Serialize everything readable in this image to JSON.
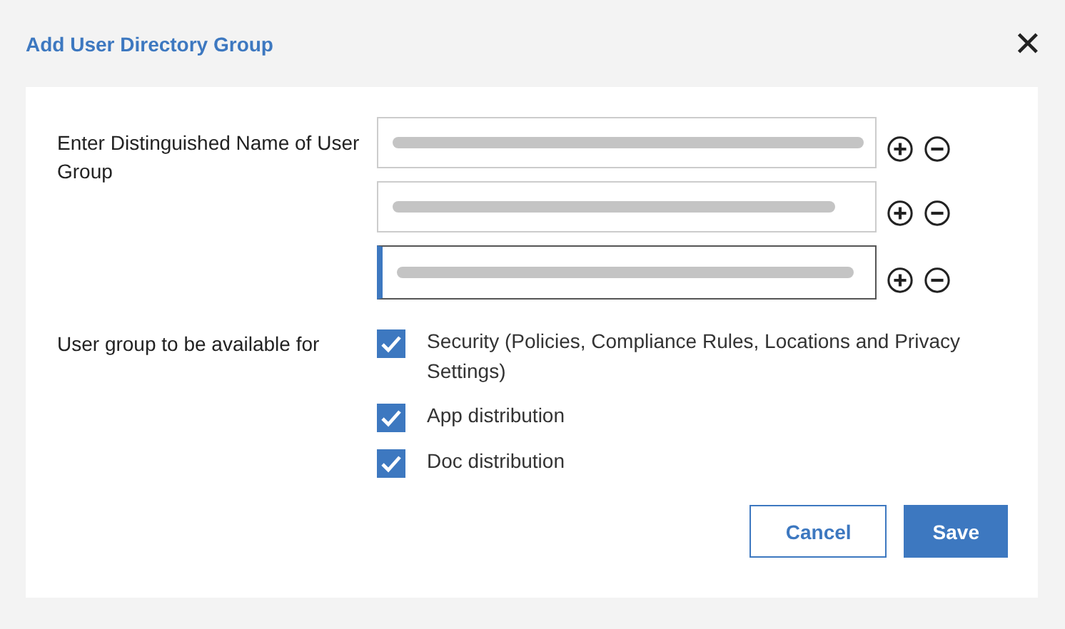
{
  "dialog": {
    "title": "Add User Directory Group",
    "close_icon": "✕"
  },
  "name_field": {
    "label": "Enter Distinguished Name of User Group",
    "entries": [
      {
        "redacted": true,
        "focused": false
      },
      {
        "redacted": true,
        "focused": false
      },
      {
        "redacted": true,
        "focused": true
      }
    ]
  },
  "availability": {
    "label": "User group to be available for",
    "options": [
      {
        "label": "Security (Policies, Compliance Rules, Locations and Privacy Settings)",
        "checked": true
      },
      {
        "label": "App distribution",
        "checked": true
      },
      {
        "label": "Doc distribution",
        "checked": true
      }
    ]
  },
  "buttons": [
    {
      "label": "Cancel",
      "kind": "secondary"
    },
    {
      "label": "Save",
      "kind": "primary"
    }
  ]
}
